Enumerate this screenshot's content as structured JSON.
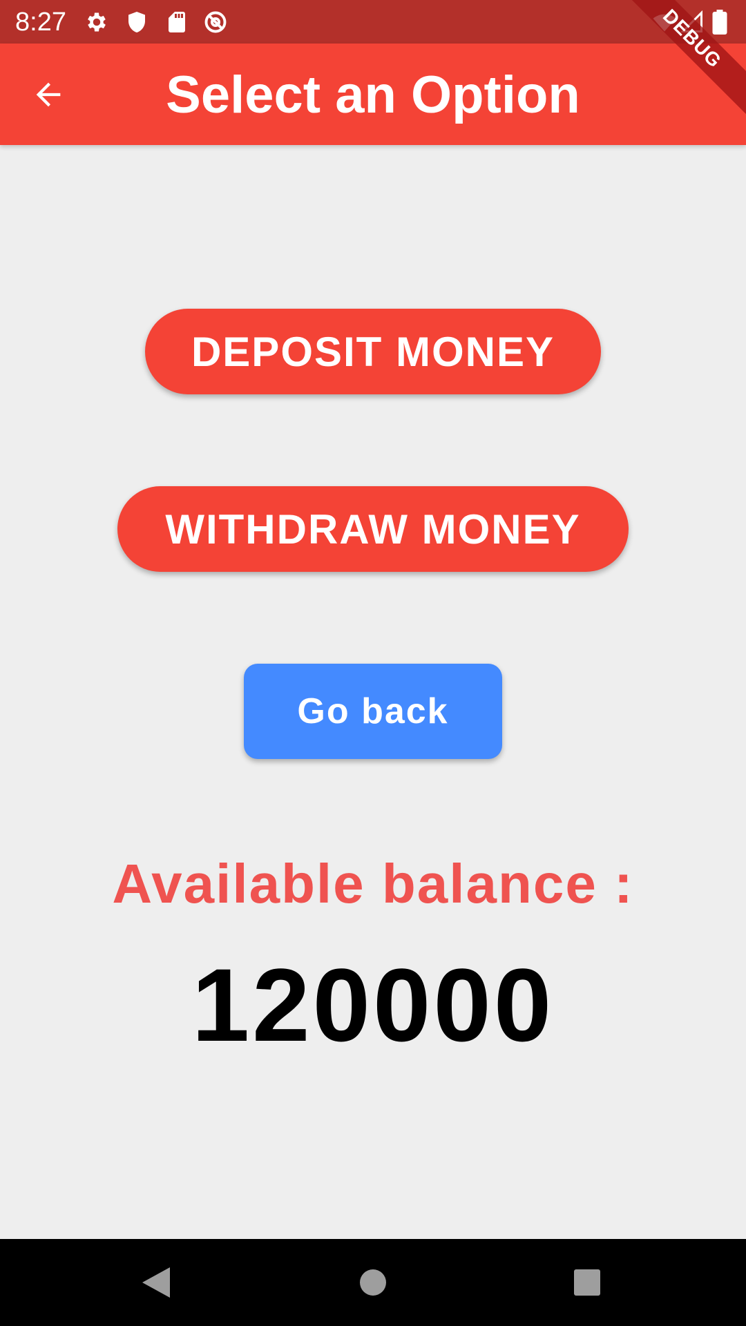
{
  "status_bar": {
    "time": "8:27",
    "left_icons": [
      "settings-icon",
      "shield-icon",
      "sd-card-icon",
      "at-sign-icon"
    ],
    "right_icons": [
      "wifi-icon",
      "cell-signal-icon",
      "battery-icon"
    ]
  },
  "debug_banner": "DEBUG",
  "app_bar": {
    "back_icon": "arrow-back-icon",
    "title": "Select an Option"
  },
  "actions": {
    "deposit_label": "DEPOSIT MONEY",
    "withdraw_label": "WITHDRAW MONEY",
    "go_back_label": "Go back"
  },
  "balance": {
    "label": "Available balance :",
    "value": "120000"
  },
  "nav_bar": {
    "icons": [
      "nav-back-icon",
      "nav-home-icon",
      "nav-recents-icon"
    ]
  },
  "colors": {
    "status_bar": "#b3302a",
    "app_bar": "#f44336",
    "primary_button": "#f44336",
    "go_back_button": "#448aff",
    "balance_label": "#ef5350",
    "background": "#eeeeee"
  }
}
